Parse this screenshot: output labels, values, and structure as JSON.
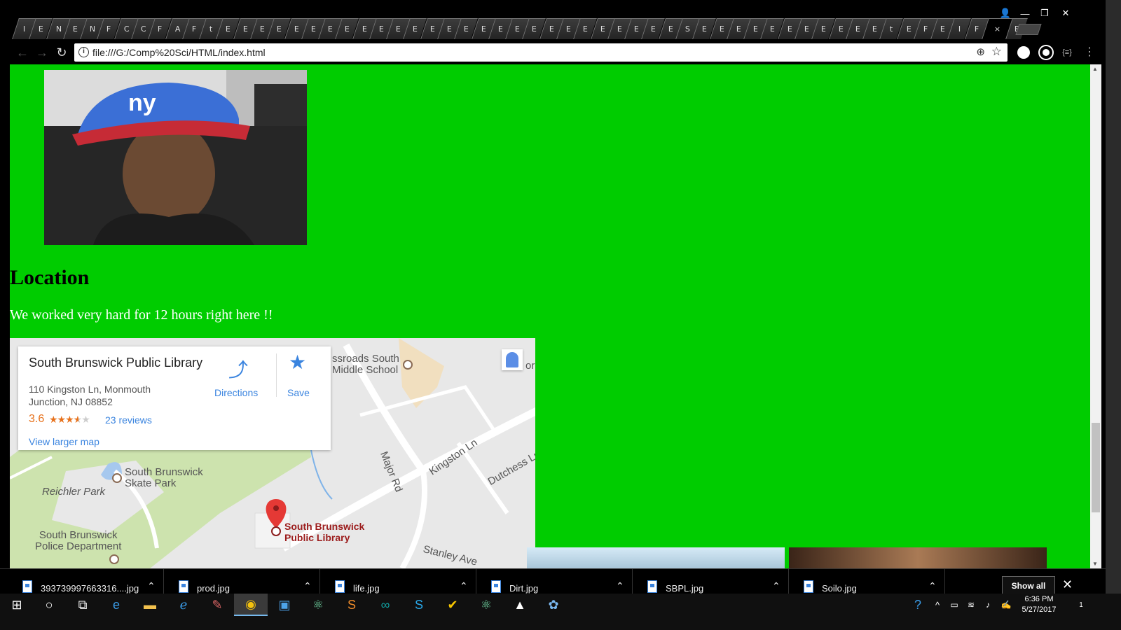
{
  "browser": {
    "tab_glyphs": [
      "I",
      "E",
      "N",
      "E",
      "N",
      "F",
      "C",
      "C",
      "F",
      "A",
      "F",
      "t",
      "E",
      "E",
      "E",
      "E",
      "E",
      "E",
      "E",
      "E",
      "E",
      "E",
      "E",
      "E",
      "E",
      "E",
      "E",
      "E",
      "E",
      "E",
      "E",
      "E",
      "E",
      "E",
      "E",
      "E",
      "E",
      "E",
      "E",
      "S",
      "E",
      "E",
      "E",
      "E",
      "E",
      "E",
      "E",
      "E",
      "E",
      "E",
      "E",
      "t",
      "E",
      "F",
      "E",
      "I",
      "F"
    ],
    "active_tab_close": "×",
    "trailing_tab": "E",
    "address": "file:///G:/Comp%20Sci/HTML/index.html"
  },
  "page": {
    "location_heading": "Location",
    "location_text": "We worked very hard for 12 hours right here !!",
    "background_color": "#00cc00"
  },
  "map": {
    "place_name": "South Brunswick Public Library",
    "address": "110 Kingston Ln, Monmouth Junction, NJ 08852",
    "rating": "3.6",
    "stars": "★★★★★",
    "reviews": "23 reviews",
    "view_larger": "View larger map",
    "directions": "Directions",
    "save": "Save",
    "labels": {
      "school": "ssroads South\nMiddle School",
      "major_rd": "Major Rd",
      "kingston": "Kingston Ln",
      "dutchess": "Dutchess Ln",
      "skate_park": "South Brunswick\nSkate Park",
      "reichler": "Reichler Park",
      "police": "South Brunswick\nPolice Department",
      "library": "South Brunswick\nPublic Library",
      "stanley": "Stanley Ave",
      "pegman_side": "or"
    }
  },
  "downloads": {
    "items": [
      {
        "name": "393739997663316....jpg"
      },
      {
        "name": "prod.jpg"
      },
      {
        "name": "life.jpg"
      },
      {
        "name": "Dirt.jpg"
      },
      {
        "name": "SBPL.jpg"
      },
      {
        "name": "Soilo.jpg"
      }
    ],
    "show_all": "Show all",
    "close": "✕"
  },
  "taskbar": {
    "time": "6:36 PM",
    "date": "5/27/2017",
    "notifications": "1"
  }
}
